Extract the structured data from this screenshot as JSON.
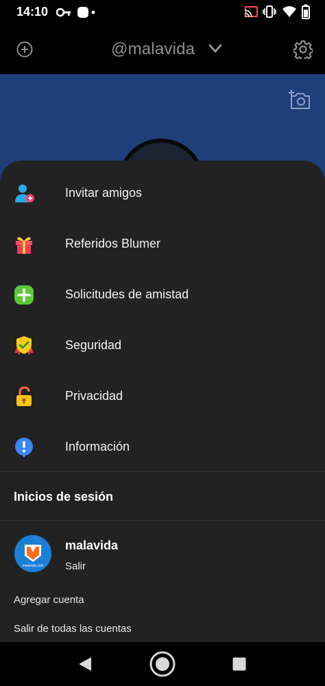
{
  "status_bar": {
    "time": "14:10",
    "icons": [
      "key-icon",
      "notification-dot-icon",
      "cast-icon",
      "vibrate-icon",
      "wifi-icon",
      "battery-icon"
    ]
  },
  "header": {
    "add_icon": "add-circle-icon",
    "username": "@malavida",
    "dropdown_icon": "chevron-down-icon",
    "settings_icon": "gear-icon"
  },
  "cover": {
    "color": "#1e3f7a",
    "camera_icon": "add-photo-icon"
  },
  "menu": {
    "items": [
      {
        "label": "Invitar amigos",
        "icon": "invite-user-icon"
      },
      {
        "label": "Referidos Blumer",
        "icon": "gift-icon"
      },
      {
        "label": "Solicitudes de amistad",
        "icon": "plus-square-icon"
      },
      {
        "label": "Seguridad",
        "icon": "shield-check-icon"
      },
      {
        "label": "Privacidad",
        "icon": "lock-open-icon"
      },
      {
        "label": "Información",
        "icon": "info-icon"
      }
    ]
  },
  "sessions": {
    "title": "Inicios de sesión",
    "account": {
      "name": "malavida",
      "action": "Salir",
      "avatar_caption": "malavida.com"
    },
    "add_account": "Agregar cuenta",
    "logout_all": "Salir de todas las cuentas"
  },
  "nav": {
    "back_icon": "back-triangle-icon",
    "home_icon": "home-circle-icon",
    "recents_icon": "recents-square-icon"
  },
  "colors": {
    "sheet": "#222223",
    "cover": "#1e3f7a",
    "text": "#f2f2f2"
  }
}
